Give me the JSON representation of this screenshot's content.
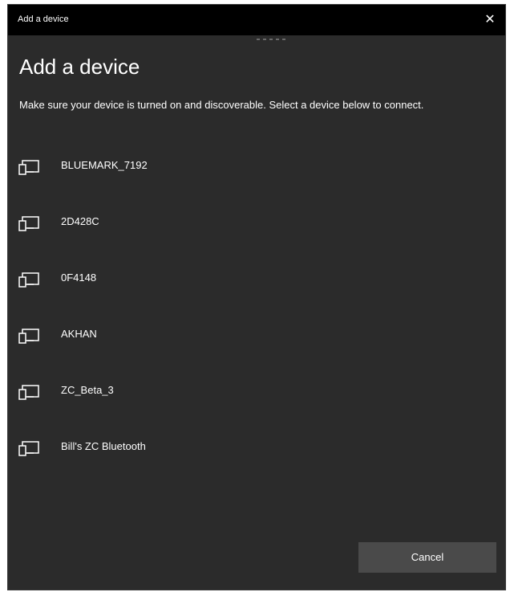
{
  "window": {
    "title": "Add a device",
    "close_glyph": "✕"
  },
  "main": {
    "heading": "Add a device",
    "description": "Make sure your device is turned on and discoverable. Select a device below to connect."
  },
  "devices": [
    {
      "name": "BLUEMARK_7192",
      "icon": "device-icon"
    },
    {
      "name": "2D428C",
      "icon": "device-icon"
    },
    {
      "name": "0F4148",
      "icon": "device-icon"
    },
    {
      "name": "AKHAN",
      "icon": "device-icon"
    },
    {
      "name": "ZC_Beta_3",
      "icon": "device-icon"
    },
    {
      "name": "Bill's ZC Bluetooth",
      "icon": "device-icon"
    }
  ],
  "footer": {
    "cancel_label": "Cancel"
  },
  "colors": {
    "titlebar": "#000000",
    "background": "#2b2b2b",
    "button": "#4a4a4a",
    "text": "#ffffff"
  }
}
